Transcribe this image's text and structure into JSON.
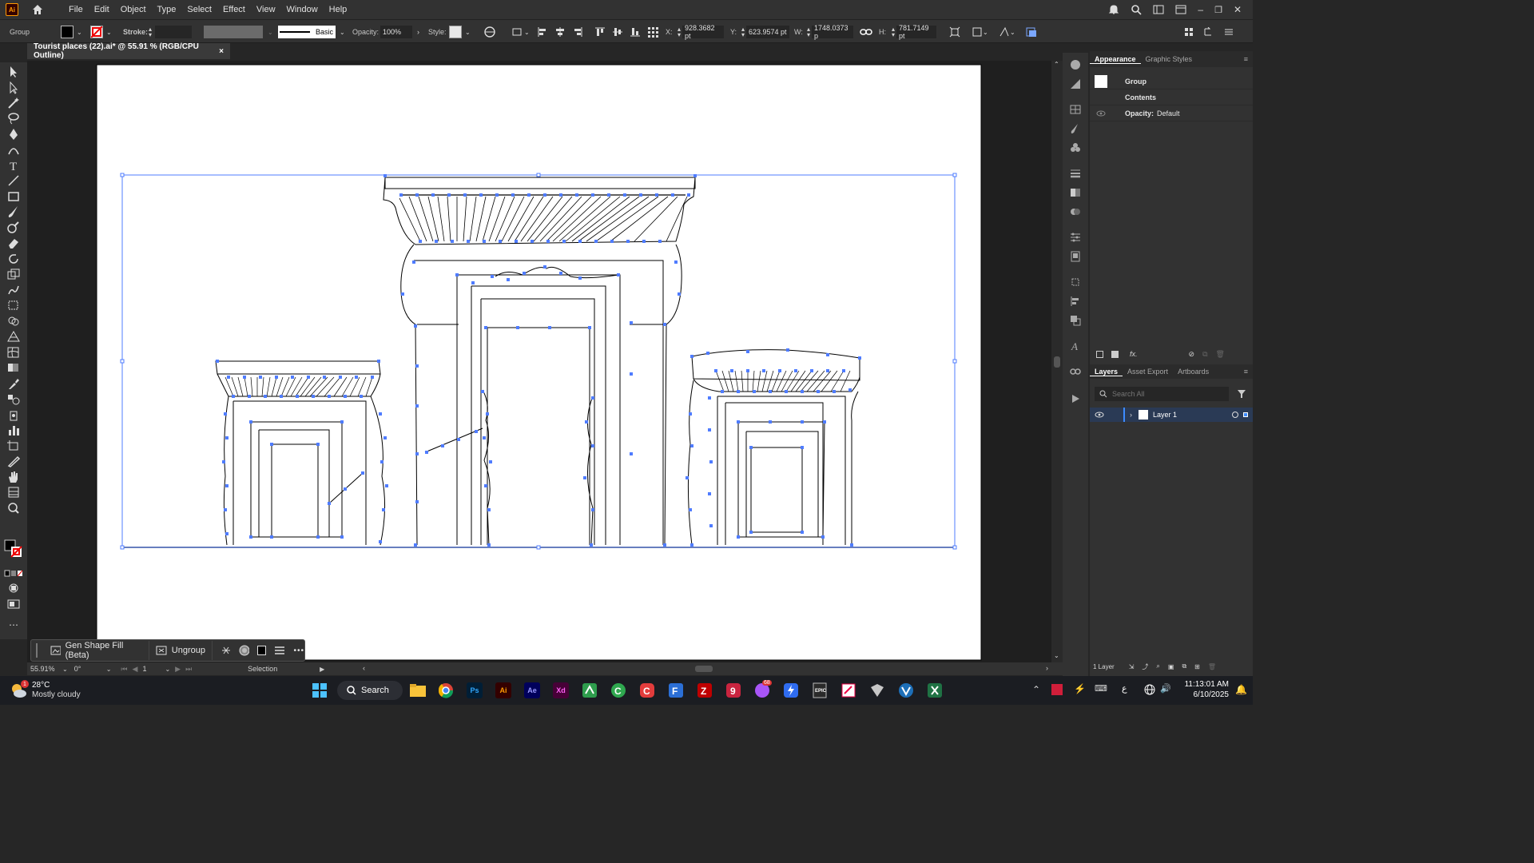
{
  "app": {
    "logo": "Ai"
  },
  "menu": [
    "File",
    "Edit",
    "Object",
    "Type",
    "Select",
    "Effect",
    "View",
    "Window",
    "Help"
  ],
  "control": {
    "selection_type": "Group",
    "stroke_label": "Stroke:",
    "brush_label": "Basic",
    "opacity_label": "Opacity:",
    "opacity_value": "100%",
    "style_label": "Style:",
    "x_label": "X:",
    "x_value": "928.3682 pt",
    "y_label": "Y:",
    "y_value": "623.9574 pt",
    "w_label": "W:",
    "w_value": "1748.0373 p",
    "h_label": "H:",
    "h_value": "781.7149 pt"
  },
  "document_tab": {
    "title": "Tourist places (22).ai* @ 55.91 % (RGB/CPU Outline)",
    "close": "×"
  },
  "context_bar": {
    "gen_fill": "Gen Shape Fill (Beta)",
    "ungroup": "Ungroup",
    "more": "•••"
  },
  "status": {
    "zoom": "55.91%",
    "rotation": "0°",
    "artboard": "1",
    "tool": "Selection"
  },
  "appearance_panel": {
    "tab_active": "Appearance",
    "tab_other": "Graphic Styles",
    "group_label": "Group",
    "contents_label": "Contents",
    "opacity_label": "Opacity:",
    "opacity_value": "Default",
    "fx_label": "fx."
  },
  "layers_panel": {
    "tabs": [
      "Layers",
      "Asset Export",
      "Artboards"
    ],
    "search_placeholder": "Search All",
    "layer_name": "Layer 1",
    "layers_count": "1 Layer"
  },
  "taskbar": {
    "weather_temp": "28°C",
    "weather_desc": "Mostly cloudy",
    "weather_badge": "1",
    "search_label": "Search",
    "time": "11:13:01 AM",
    "date": "6/10/2025",
    "lang": "ع",
    "app_badge": "68",
    "apps": [
      {
        "label": "Ps",
        "color": "#31a8ff",
        "bg": "#001e36"
      },
      {
        "label": "Ai",
        "color": "#ff9a00",
        "bg": "#330000"
      },
      {
        "label": "Ae",
        "color": "#9999ff",
        "bg": "#00005b"
      },
      {
        "label": "Xd",
        "color": "#ff61f6",
        "bg": "#470137"
      }
    ]
  },
  "colors": {
    "selection": "#4f7cff",
    "accent": "#3d8bff"
  }
}
